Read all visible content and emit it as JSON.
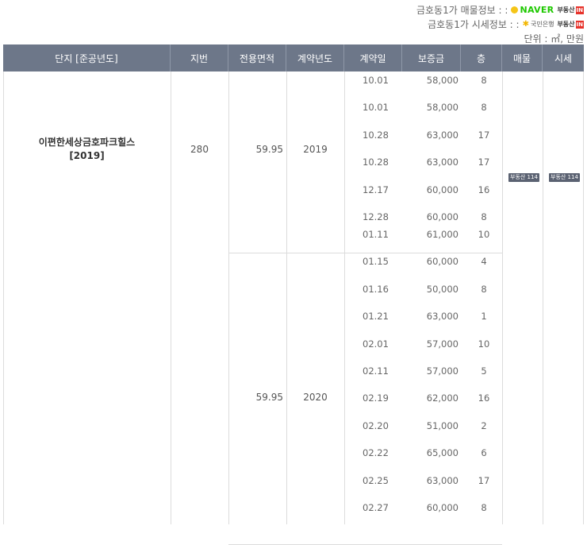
{
  "header": {
    "listing_info_label": "금호동1가 매물정보 : :",
    "price_info_label": "금호동1가 시세정보 : :",
    "unit_label": "단위 : ㎡, 만원",
    "naver_text": "NAVER",
    "bds_text": "부동산",
    "bds_box": "IN",
    "kb_text": "국민은행"
  },
  "columns": {
    "complex": "단지 [준공년도]",
    "lot": "지번",
    "area": "전용면적",
    "year": "계약년도",
    "date": "계약일",
    "deposit": "보증금",
    "floor": "층",
    "listing": "매물",
    "price": "시세"
  },
  "complex": {
    "name": "이편한세상금호파크힐스",
    "built_year": "[2019]",
    "lot": "280",
    "listing_badge": "부동산 114",
    "price_badge": "부동산 114"
  },
  "groups": [
    {
      "area": "59.95",
      "year": "2019",
      "rows": [
        {
          "date": "10.01",
          "deposit": "58,000",
          "floor": "8"
        },
        {
          "date": "10.01",
          "deposit": "58,000",
          "floor": "8"
        },
        {
          "date": "10.28",
          "deposit": "63,000",
          "floor": "17"
        },
        {
          "date": "10.28",
          "deposit": "63,000",
          "floor": "17"
        },
        {
          "date": "12.17",
          "deposit": "60,000",
          "floor": "16"
        },
        {
          "date": "12.28",
          "deposit": "60,000",
          "floor": "8"
        }
      ]
    },
    {
      "area": "59.95",
      "year": "2020",
      "rows": [
        {
          "date": "01.11",
          "deposit": "61,000",
          "floor": "10"
        },
        {
          "date": "01.15",
          "deposit": "60,000",
          "floor": "4"
        },
        {
          "date": "01.16",
          "deposit": "50,000",
          "floor": "8"
        },
        {
          "date": "01.21",
          "deposit": "63,000",
          "floor": "1"
        },
        {
          "date": "02.01",
          "deposit": "57,000",
          "floor": "10"
        },
        {
          "date": "02.11",
          "deposit": "57,000",
          "floor": "5"
        },
        {
          "date": "02.19",
          "deposit": "62,000",
          "floor": "16"
        },
        {
          "date": "02.20",
          "deposit": "51,000",
          "floor": "2"
        },
        {
          "date": "02.22",
          "deposit": "65,000",
          "floor": "6"
        },
        {
          "date": "02.25",
          "deposit": "63,000",
          "floor": "17"
        },
        {
          "date": "02.27",
          "deposit": "60,000",
          "floor": "8"
        }
      ]
    }
  ]
}
